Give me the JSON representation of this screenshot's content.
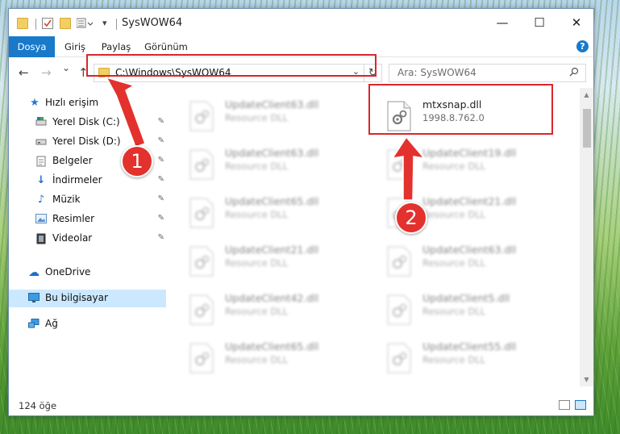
{
  "window": {
    "title": "SysWOW64",
    "minimize_label": "—",
    "maximize_label": "☐",
    "close_label": "✕"
  },
  "ribbon": {
    "tabs": [
      "Dosya",
      "Giriş",
      "Paylaş",
      "Görünüm"
    ],
    "active_tab": "Dosya",
    "help_label": "?"
  },
  "nav": {
    "back": "←",
    "forward": "→",
    "history": "⌄",
    "up": "↑",
    "address": "C:\\Windows\\SysWOW64",
    "address_dropdown": "⌄",
    "refresh": "↻"
  },
  "search": {
    "placeholder": "Ara: SysWOW64",
    "icon": "⌕"
  },
  "sidebar": {
    "items": [
      {
        "label": "Hızlı erişim",
        "icon": "star-icon",
        "glyph": "★",
        "pinned": false
      },
      {
        "label": "Yerel Disk (C:)",
        "icon": "drive-icon",
        "glyph": "▬",
        "pinned": true
      },
      {
        "label": "Yerel Disk (D:)",
        "icon": "drive-icon",
        "glyph": "▬",
        "pinned": true
      },
      {
        "label": "Belgeler",
        "icon": "documents-icon",
        "glyph": "▤",
        "pinned": true
      },
      {
        "label": "İndirmeler",
        "icon": "downloads-icon",
        "glyph": "↓",
        "pinned": true
      },
      {
        "label": "Müzik",
        "icon": "music-icon",
        "glyph": "♪",
        "pinned": true
      },
      {
        "label": "Resimler",
        "icon": "pictures-icon",
        "glyph": "▣",
        "pinned": true
      },
      {
        "label": "Videolar",
        "icon": "videos-icon",
        "glyph": "▦",
        "pinned": true
      },
      {
        "label": "OneDrive",
        "icon": "cloud-icon",
        "glyph": "☁",
        "pinned": false
      },
      {
        "label": "Bu bilgisayar",
        "icon": "computer-icon",
        "glyph": "▭",
        "pinned": false,
        "selected": true
      },
      {
        "label": "Ağ",
        "icon": "network-icon",
        "glyph": "⧉",
        "pinned": false
      }
    ],
    "pin_glyph": "📌"
  },
  "files": [
    {
      "name": "UpdateClient63.dll",
      "type": "Resource DLL",
      "blurred": true
    },
    {
      "name": "mtxsnap.dll",
      "type": "1998.8.762.0",
      "blurred": false
    },
    {
      "name": "UpdateClient63.dll",
      "type": "Resource DLL",
      "blurred": true
    },
    {
      "name": "UpdateClient19.dll",
      "type": "Resource DLL",
      "blurred": true
    },
    {
      "name": "UpdateClient65.dll",
      "type": "Resource DLL",
      "blurred": true
    },
    {
      "name": "UpdateClient21.dll",
      "type": "Resource DLL",
      "blurred": true
    },
    {
      "name": "UpdateClient21.dll",
      "type": "Resource DLL",
      "blurred": true
    },
    {
      "name": "UpdateClient63.dll",
      "type": "Resource DLL",
      "blurred": true
    },
    {
      "name": "UpdateClient42.dll",
      "type": "Resource DLL",
      "blurred": true
    },
    {
      "name": "UpdateClient5.dll",
      "type": "Resource DLL",
      "blurred": true
    },
    {
      "name": "UpdateClient65.dll",
      "type": "Resource DLL",
      "blurred": true
    },
    {
      "name": "UpdateClient55.dll",
      "type": "Resource DLL",
      "blurred": true
    }
  ],
  "status": {
    "count": "124 öğe"
  },
  "callouts": [
    "1",
    "2"
  ],
  "colors": {
    "accent": "#1979ca",
    "highlight": "#d9262b",
    "selected_bg": "#cce8ff"
  }
}
